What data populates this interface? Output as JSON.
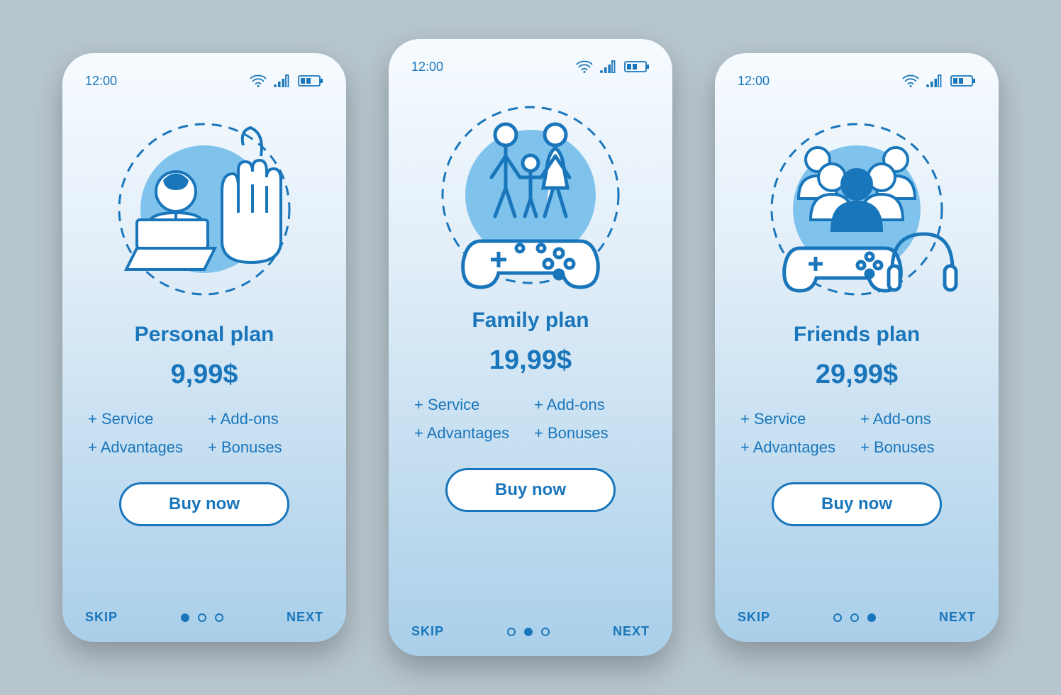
{
  "status": {
    "time": "12:00",
    "wifi_icon": "wifi",
    "signal_icon": "signal",
    "battery_icon": "battery"
  },
  "plans": [
    {
      "icon": "personal-icon",
      "title": "Personal plan",
      "price": "9,99$",
      "features": [
        "+ Service",
        "+ Add-ons",
        "+ Advantages",
        "+ Bonuses"
      ],
      "buy_label": "Buy now",
      "skip_label": "SKIP",
      "next_label": "NEXT",
      "active_dot": 0
    },
    {
      "icon": "family-icon",
      "title": "Family plan",
      "price": "19,99$",
      "features": [
        "+ Service",
        "+ Add-ons",
        "+ Advantages",
        "+ Bonuses"
      ],
      "buy_label": "Buy now",
      "skip_label": "SKIP",
      "next_label": "NEXT",
      "active_dot": 1
    },
    {
      "icon": "friends-icon",
      "title": "Friends plan",
      "price": "29,99$",
      "features": [
        "+ Service",
        "+ Add-ons",
        "+ Advantages",
        "+ Bonuses"
      ],
      "buy_label": "Buy now",
      "skip_label": "SKIP",
      "next_label": "NEXT",
      "active_dot": 2
    }
  ]
}
